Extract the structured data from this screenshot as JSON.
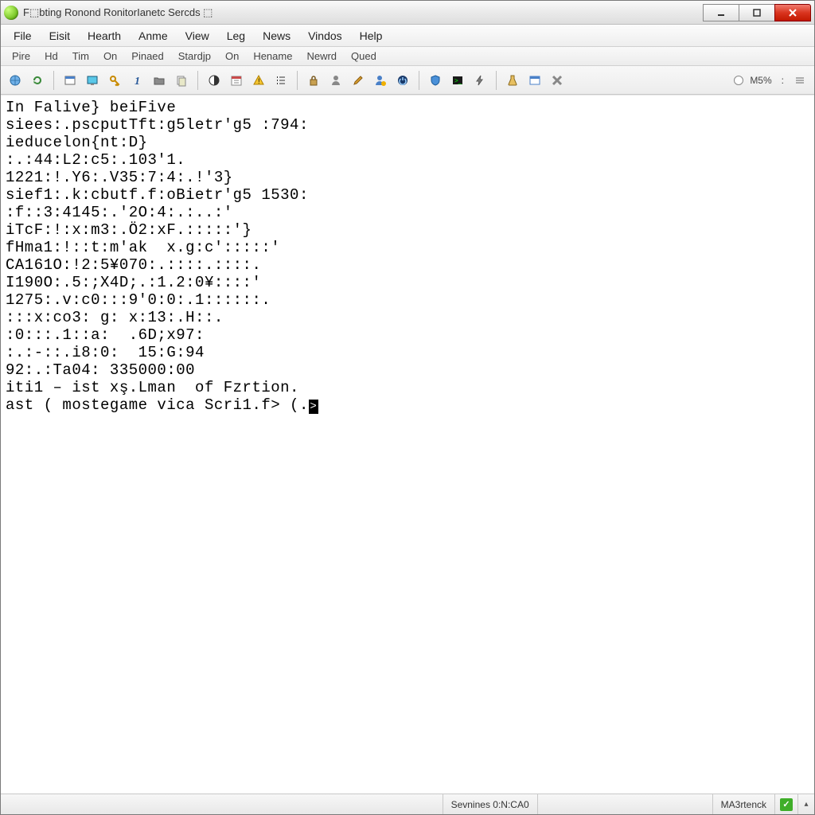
{
  "title": "F⬚bting Ronond RonitorIanetc Sercds ⬚",
  "menu": [
    "File",
    "Eisit",
    "Hearth",
    "Anme",
    "View",
    "Leg",
    "News",
    "Vindos",
    "Help"
  ],
  "secmenu": [
    "Pire",
    "Hd",
    "Tim",
    "On",
    "Pinaed",
    "Stardjp",
    "On",
    "Hename",
    "Newrd",
    "Qued"
  ],
  "toolbar_right_label": "M5%",
  "toolbar_right_suffix": ":",
  "console_lines": [
    "In Falive} beiFive",
    "siees:.pscputTft:g5letr'g5 :794:",
    "ieducelon{nt:D}",
    ":.:44:L2:c5:.103'1.",
    "1221:!.Y6:.V35:7:4:.!'3}",
    "sief1:.k:cbutf.f:oBietr'g5 1530:",
    ":f::3:4145:.'2O:4:.:..:'",
    "iTcF:!:x:m3:.Ö2:xF.:::::'}",
    "fHma1:!::t:m'ak  x.g:c':::::'",
    "CA161O:!2:5¥070:.::::.::::.",
    "I190O:.5:;X4D;.:1.2:0¥::::'",
    "1275:.v:c0:::9'0:0:.1::::::.",
    ":::x:co3: g: x:13:.H::.",
    ":0:::.1::a:  .6D;x97:",
    ":.:-::.i8:0:  15:G:94",
    "92:.:Ta04: 335000:00",
    "iti1 – ist xş.Lman  of Fzrtion.",
    "ast ( mostegame vica Scri1.f> (."
  ],
  "cursor_char": ">",
  "status": {
    "left": "",
    "center": "Sevnines 0:N:CA0",
    "right": "MA3rtenck"
  }
}
